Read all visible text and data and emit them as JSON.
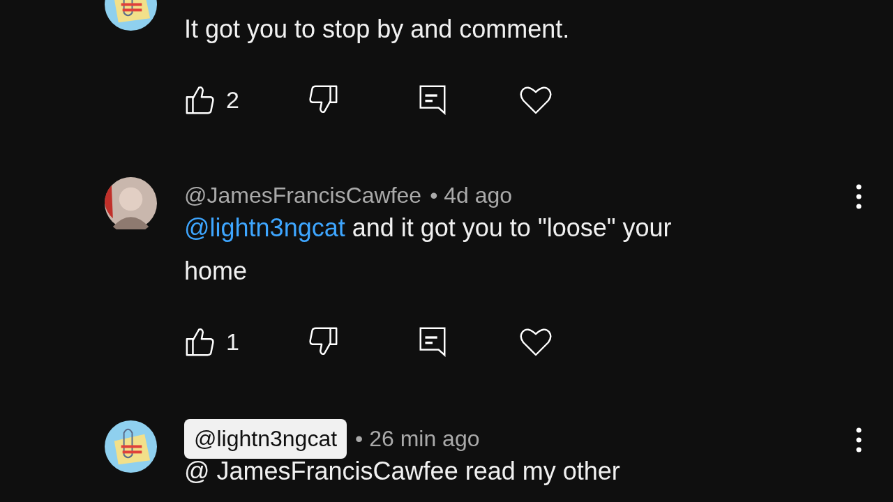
{
  "comments": [
    {
      "avatar": {
        "kind": "cartoon"
      },
      "text": [
        {
          "kind": "plain",
          "text": "It got you to stop by and comment."
        }
      ],
      "actions": {
        "likes": "2"
      }
    },
    {
      "avatar": {
        "kind": "person"
      },
      "author": "@JamesFrancisCawfee",
      "author_highlighted": false,
      "time": "• 4d ago",
      "text": [
        {
          "kind": "mention",
          "text": "@lightn3ngcat"
        },
        {
          "kind": "plain",
          "text": " and it got you to \"loose\" your home"
        }
      ],
      "actions": {
        "likes": "1"
      }
    },
    {
      "avatar": {
        "kind": "cartoon"
      },
      "author": "@lightn3ngcat",
      "author_highlighted": true,
      "time": "• 26 min ago",
      "text": [
        {
          "kind": "plain",
          "text": "@ JamesFrancisCawfee  read my other"
        }
      ]
    }
  ]
}
